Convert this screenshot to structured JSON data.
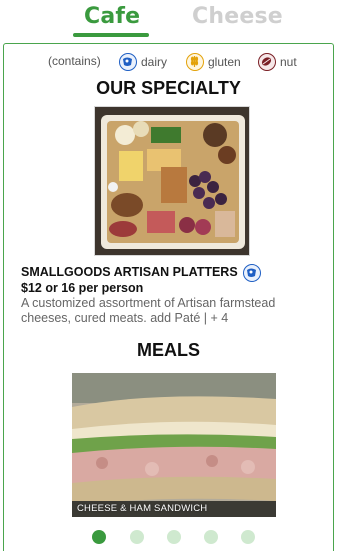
{
  "tabs": [
    {
      "label": "Cafe",
      "active": true
    },
    {
      "label": "Cheese",
      "active": false
    }
  ],
  "colors": {
    "accent": "#3a9a3e",
    "inactive_tab": "#cfcfcf",
    "dot_inactive": "#cfe9cf"
  },
  "allergens": {
    "prefix": "(contains)",
    "items": [
      {
        "label": "dairy",
        "icon": "dairy-icon"
      },
      {
        "label": "gluten",
        "icon": "gluten-icon"
      },
      {
        "label": "nut",
        "icon": "nut-icon"
      }
    ]
  },
  "sections": {
    "specialty": {
      "heading": "OUR SPECIALTY",
      "item": {
        "title": "SMALLGOODS ARTISAN PLATTERS",
        "allergen_icon": "dairy-icon",
        "price": "$12 or 16 per person",
        "description": "A customized assortment of Artisan farmstead cheeses, cured meats. add Paté | + 4"
      }
    },
    "meals": {
      "heading": "MEALS",
      "caption": "CHEESE & HAM SANDWICH"
    }
  },
  "carousel": {
    "count": 5,
    "active_index": 0
  }
}
